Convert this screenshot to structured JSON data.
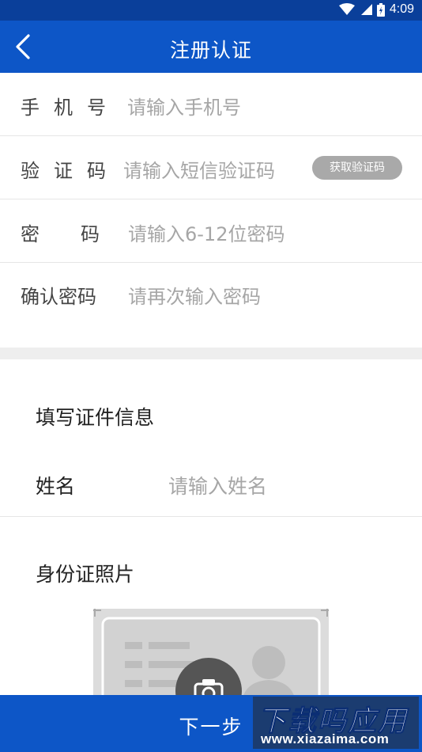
{
  "status_bar": {
    "time": "4:09",
    "icons": [
      "wifi-icon",
      "signal-icon",
      "battery-icon"
    ]
  },
  "header": {
    "title": "注册认证",
    "back_icon": "chevron-left-icon"
  },
  "form": {
    "phone": {
      "label": "手机号",
      "placeholder": "请输入手机号"
    },
    "code": {
      "label": "验证码",
      "placeholder": "请输入短信验证码",
      "button": "获取验证码"
    },
    "password": {
      "label": "密码",
      "placeholder": "请输入6-12位密码"
    },
    "confirm": {
      "label": "确认密码",
      "placeholder": "请再次输入密码"
    }
  },
  "certificate": {
    "section_title": "填写证件信息",
    "name": {
      "label": "姓名",
      "placeholder": "请输入姓名"
    },
    "photo_title": "身份证照片"
  },
  "footer": {
    "next_label": "下一步"
  },
  "watermark": {
    "title": "下载吗应用",
    "url": "www.xiazaima.com"
  },
  "colors": {
    "primary": "#0d56c7",
    "status_bar": "#0a3f9a",
    "placeholder": "#a6a6a6",
    "button_gray": "#a9a9a9"
  }
}
